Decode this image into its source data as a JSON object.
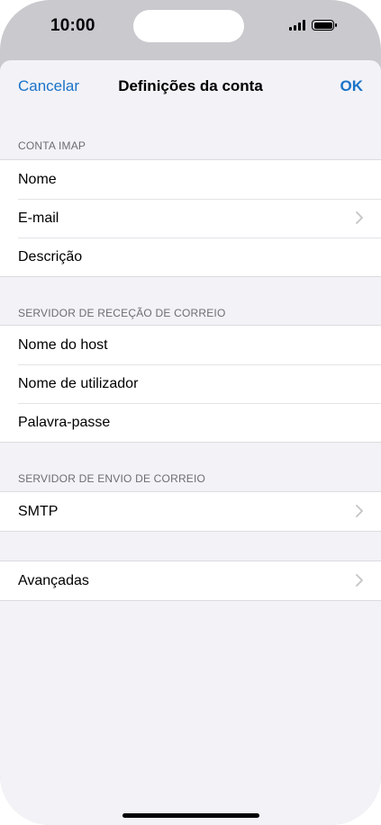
{
  "status_bar": {
    "time": "10:00"
  },
  "nav": {
    "cancel_label": "Cancelar",
    "title": "Definições da conta",
    "ok_label": "OK"
  },
  "sections": [
    {
      "header": "CONTA IMAP",
      "rows": [
        {
          "label": "Nome",
          "chevron": false
        },
        {
          "label": "E-mail",
          "chevron": true
        },
        {
          "label": "Descrição",
          "chevron": false
        }
      ]
    },
    {
      "header": "SERVIDOR DE RECEÇÃO DE CORREIO",
      "rows": [
        {
          "label": "Nome do host",
          "chevron": false
        },
        {
          "label": "Nome de utilizador",
          "chevron": false
        },
        {
          "label": "Palavra-passe",
          "chevron": false
        }
      ]
    },
    {
      "header": "SERVIDOR DE ENVIO DE CORREIO",
      "rows": [
        {
          "label": "SMTP",
          "chevron": true
        }
      ]
    },
    {
      "header": "",
      "rows": [
        {
          "label": "Avançadas",
          "chevron": true
        }
      ]
    }
  ],
  "icons": {
    "chevron": "chevron-right-icon",
    "signal": "cellular-signal-icon",
    "battery": "battery-icon"
  },
  "colors": {
    "accent": "#1a73c8",
    "grouped_background": "#f2f2f7",
    "section_header": "#6d6d72"
  }
}
